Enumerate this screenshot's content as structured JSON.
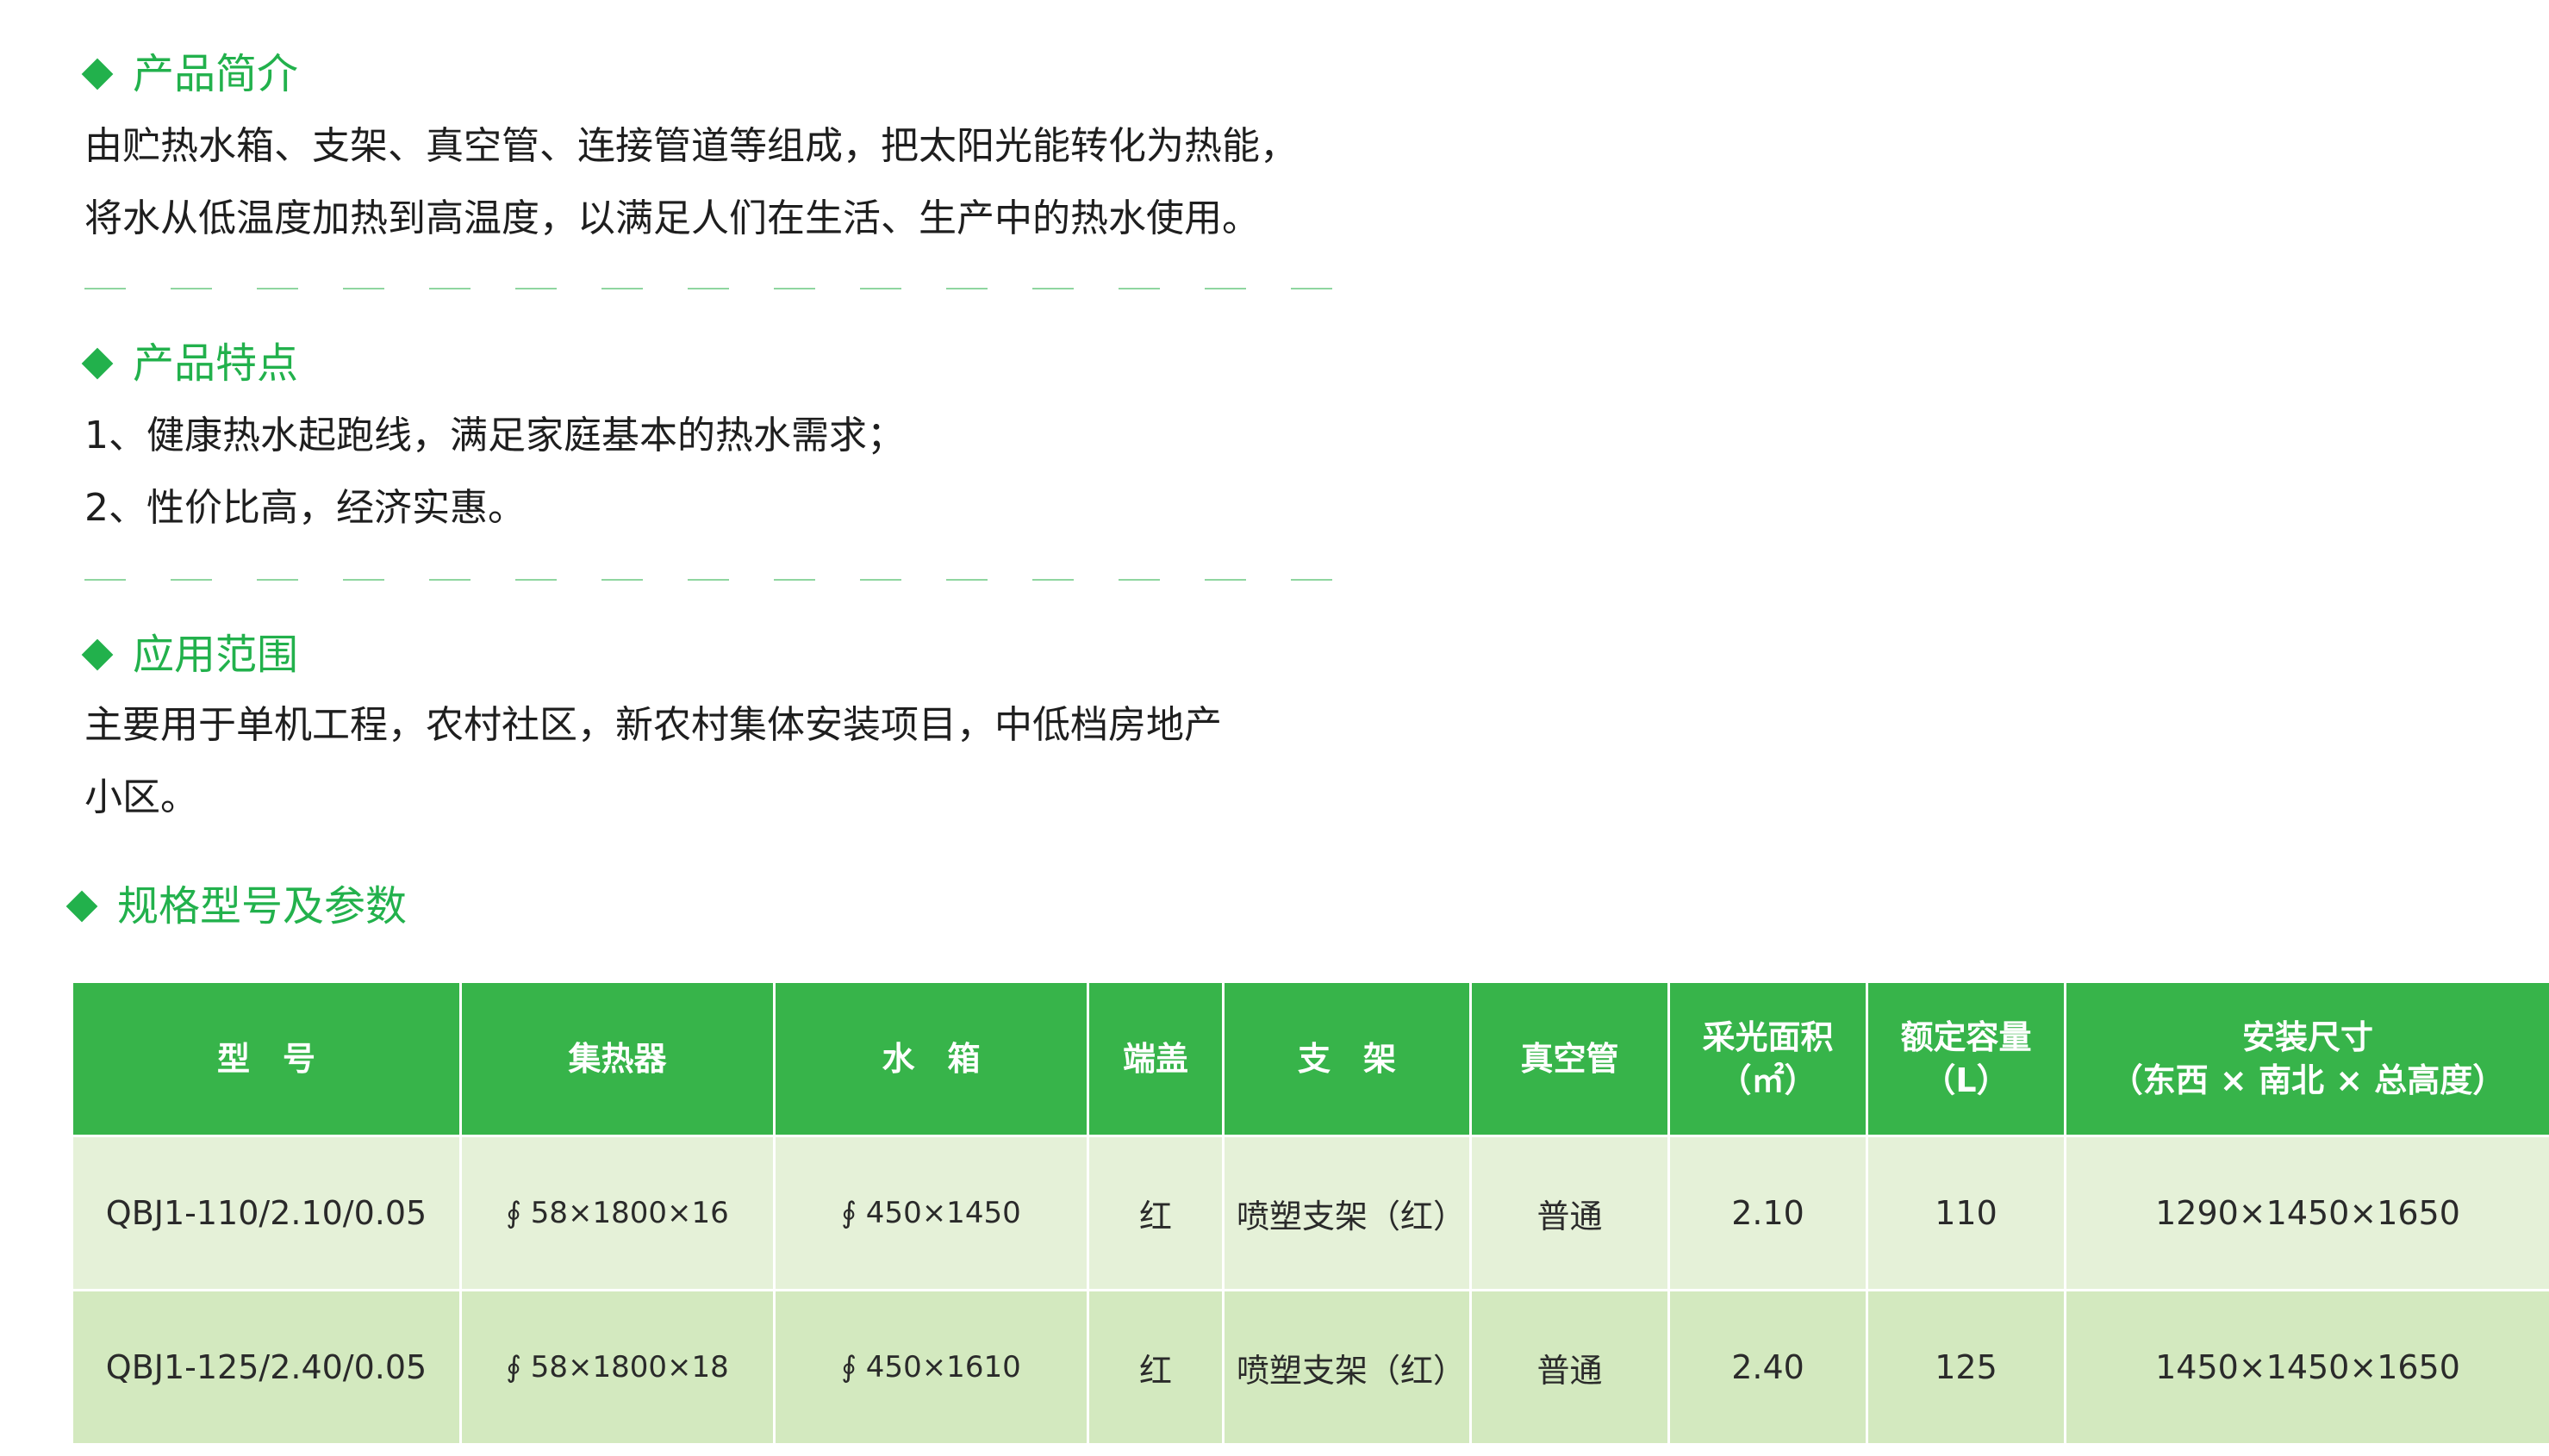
{
  "intro": {
    "title": "产品简介",
    "lines": [
      "由贮热水箱、支架、真空管、连接管道等组成，把太阳光能转化为热能，",
      "将水从低温度加热到高温度，以满足人们在生活、生产中的热水使用。"
    ]
  },
  "features": {
    "title": "产品特点",
    "lines": [
      "1、健康热水起跑线，满足家庭基本的热水需求；",
      "2、性价比高，经济实惠。"
    ]
  },
  "application": {
    "title": "应用范围",
    "lines": [
      "主要用于单机工程，农村社区，新农村集体安装项目，中低档房地产",
      "小区。"
    ]
  },
  "specs": {
    "title": "规格型号及参数",
    "headers": [
      [
        "型　号"
      ],
      [
        "集热器"
      ],
      [
        "水　箱"
      ],
      [
        "端盖"
      ],
      [
        "支　架"
      ],
      [
        "真空管"
      ],
      [
        "采光面积",
        "（㎡）"
      ],
      [
        "额定容量",
        "（L）"
      ],
      [
        "安装尺寸",
        "（东西 × 南北 × 总高度）"
      ]
    ],
    "rows": [
      [
        "QBJ1-110/2.10/0.05",
        "∮ 58×1800×16",
        "∮ 450×1450",
        "红",
        "喷塑支架（红）",
        "普通",
        "2.10",
        "110",
        "1290×1450×1650"
      ],
      [
        "QBJ1-125/2.40/0.05",
        "∮ 58×1800×18",
        "∮ 450×1610",
        "红",
        "喷塑支架（红）",
        "普通",
        "2.40",
        "125",
        "1450×1450×1650"
      ]
    ]
  },
  "colors": {
    "accent": "#22b14c",
    "table_header": "#37b44a",
    "row_light": "#e5f1d8",
    "row_dark": "#d3e9bf"
  },
  "icons": {
    "section_marker": "diamond-bullet-icon"
  }
}
